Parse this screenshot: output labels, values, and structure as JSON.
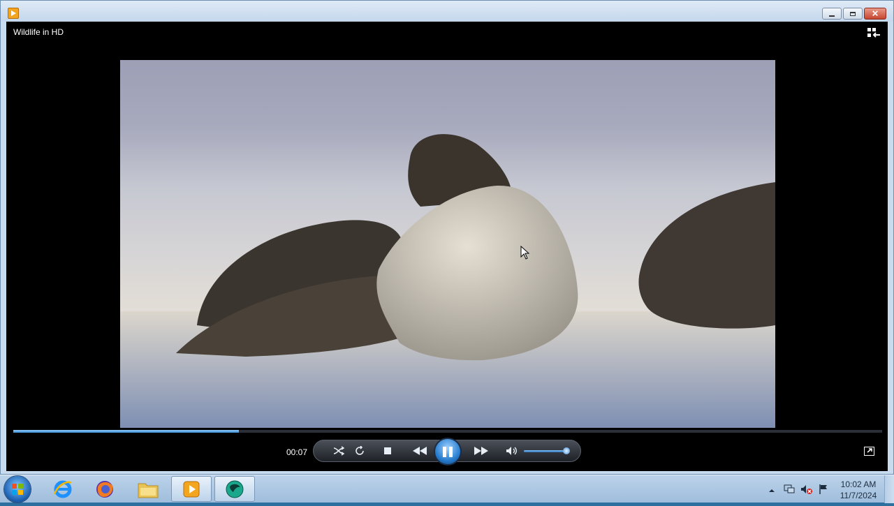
{
  "window": {
    "video_title": "Wildlife in HD",
    "controls": [
      "minimize",
      "maximize",
      "close"
    ]
  },
  "playback": {
    "time": "00:07",
    "seek_progress": 0.26,
    "volume": 1.0,
    "state": "playing"
  },
  "icons": {
    "shuffle": "shuffle-icon",
    "repeat": "repeat-icon",
    "stop": "stop-icon",
    "previous": "previous-icon",
    "pause": "pause-icon",
    "next": "next-icon",
    "mute": "volume-icon",
    "fullscreen": "fullscreen-icon",
    "switch_library": "switch-to-library-icon"
  },
  "taskbar": {
    "apps": [
      "Internet Explorer",
      "Firefox",
      "File Explorer",
      "Windows Media Player",
      "Other App"
    ],
    "tray": [
      "show-hidden-icons",
      "network-icon",
      "volume-muted-icon",
      "action-center-flag-icon"
    ],
    "clock_time": "10:02 AM",
    "clock_date": "11/7/2024"
  },
  "colors": {
    "accent": "#3b8fd6",
    "player_bg": "#000000"
  }
}
